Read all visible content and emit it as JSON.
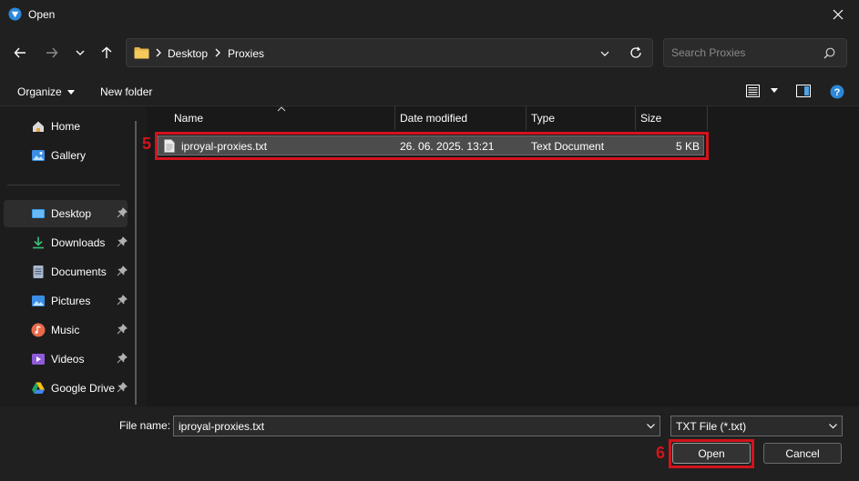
{
  "window": {
    "title": "Open"
  },
  "address": {
    "crumbs": [
      "Desktop",
      "Proxies"
    ]
  },
  "search": {
    "placeholder": "Search Proxies"
  },
  "commands": {
    "organize": "Organize",
    "new_folder": "New folder"
  },
  "sidebar": {
    "items": [
      {
        "label": "Home",
        "icon": "home-icon",
        "pinned": false
      },
      {
        "label": "Gallery",
        "icon": "gallery-icon",
        "pinned": false
      },
      {
        "label": "Desktop",
        "icon": "desktop-icon",
        "pinned": true,
        "selected": true
      },
      {
        "label": "Downloads",
        "icon": "download-icon",
        "pinned": true
      },
      {
        "label": "Documents",
        "icon": "documents-icon",
        "pinned": true
      },
      {
        "label": "Pictures",
        "icon": "pictures-icon",
        "pinned": true
      },
      {
        "label": "Music",
        "icon": "music-icon",
        "pinned": true
      },
      {
        "label": "Videos",
        "icon": "videos-icon",
        "pinned": true
      },
      {
        "label": "Google Drive",
        "icon": "google-drive-icon",
        "pinned": true
      }
    ]
  },
  "columns": {
    "name": "Name",
    "date": "Date modified",
    "type": "Type",
    "size": "Size"
  },
  "files": [
    {
      "name": "iproyal-proxies.txt",
      "date": "26. 06. 2025. 13:21",
      "type": "Text Document",
      "size": "5 KB"
    }
  ],
  "bottom": {
    "filename_label": "File name:",
    "filename_value": "iproyal-proxies.txt",
    "filetype": "TXT File (*.txt)",
    "open": "Open",
    "cancel": "Cancel"
  },
  "annotations": {
    "step_file": "5",
    "step_open": "6"
  },
  "colors": {
    "highlight": "#d3131c",
    "background": "#1c1c1c",
    "accent": "#2b88d8"
  }
}
